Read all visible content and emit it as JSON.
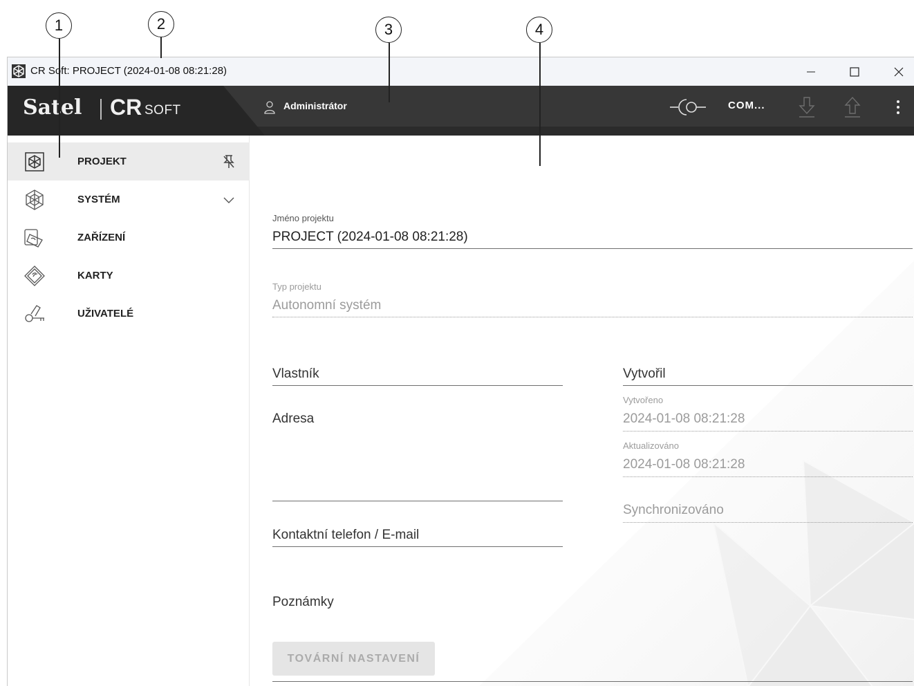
{
  "callouts": [
    "1",
    "2",
    "3",
    "4"
  ],
  "window": {
    "title": "CR Soft: PROJECT (2024-01-08 08:21:28)",
    "controls": {
      "minimize": "minimize-icon",
      "maximize": "maximize-icon",
      "close": "close-icon"
    }
  },
  "header": {
    "logo_brand": "Satel",
    "logo_product": "CR",
    "logo_suffix": "SOFT",
    "user": "Administrátor",
    "connection_label": "COM...",
    "icons": [
      "user-icon",
      "connection-icon",
      "download-icon",
      "upload-icon",
      "more-vert-icon"
    ]
  },
  "sidebar": {
    "items": [
      {
        "label": "PROJEKT",
        "icon": "project-icon",
        "right_icon": "pin-off-icon",
        "active": true
      },
      {
        "label": "SYSTÉM",
        "icon": "system-icon",
        "right_icon": "chevron-down-icon",
        "active": false
      },
      {
        "label": "ZAŘÍZENÍ",
        "icon": "devices-icon",
        "active": false
      },
      {
        "label": "KARTY",
        "icon": "cards-icon",
        "active": false
      },
      {
        "label": "UŽIVATELÉ",
        "icon": "users-key-icon",
        "active": false
      }
    ]
  },
  "form": {
    "project_name": {
      "label": "Jméno projektu",
      "value": "PROJECT (2024-01-08 08:21:28)"
    },
    "project_type": {
      "label": "Typ projektu",
      "value": "Autonomní systém"
    },
    "owner": {
      "label": "Vlastník",
      "value": ""
    },
    "address": {
      "label": "Adresa",
      "value": ""
    },
    "contact": {
      "label": "Kontaktní telefon / E-mail",
      "value": ""
    },
    "notes": {
      "label": "Poznámky",
      "value": ""
    },
    "created_by": {
      "label": "Vytvořil",
      "value": ""
    },
    "created": {
      "label": "Vytvořeno",
      "value": "2024-01-08 08:21:28"
    },
    "updated": {
      "label": "Aktualizováno",
      "value": "2024-01-08 08:21:28"
    },
    "synced": {
      "label": "Synchronizováno",
      "value": ""
    },
    "factory_button": "TOVÁRNÍ NASTAVENÍ"
  },
  "colors": {
    "header_bg": "#373737",
    "logo_bg": "#262626",
    "active_item": "#ebebeb",
    "titlebar": "#f3f5f9"
  }
}
